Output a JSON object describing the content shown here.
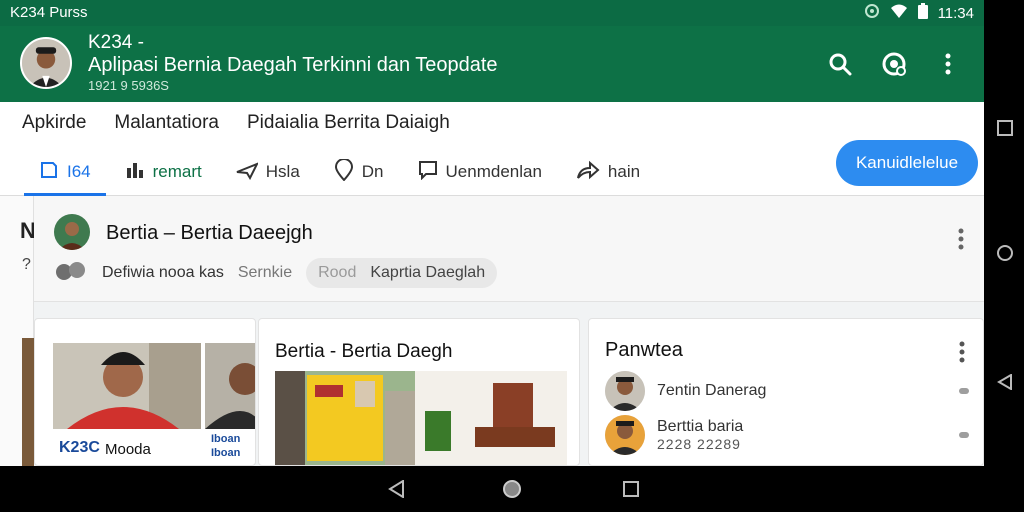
{
  "status_bar": {
    "carrier": "K234 Purss",
    "time": "11:34"
  },
  "app_bar": {
    "title_line1": "K234 -",
    "title_line2": "Aplipasi Bernia Daegah Terkinni dan Teopdate",
    "subtitle": "1921 9 5936S",
    "icons": [
      "search-icon",
      "notification-icon",
      "more-vertical-icon"
    ]
  },
  "breadcrumbs": [
    "Apkirde",
    "Malantatiora",
    "Pidaialia Berrita Daiaigh"
  ],
  "tabs": [
    {
      "icon": "document-icon",
      "label": "I64",
      "active": true
    },
    {
      "icon": "bar-chart-icon",
      "label": "remart",
      "active": false
    },
    {
      "icon": "plane-icon",
      "label": "Hsla",
      "active": false
    },
    {
      "icon": "pin-icon",
      "label": "Dn",
      "active": false
    },
    {
      "icon": "chat-icon",
      "label": "Uenmdenlan",
      "active": false
    },
    {
      "icon": "share-icon",
      "label": "hain",
      "active": false
    }
  ],
  "primary_button": {
    "label": "Kanuidlelelue"
  },
  "left_stub": {
    "letter": "N",
    "sub": "?"
  },
  "post": {
    "title": "Bertia – Bertia Daeejgh",
    "meta_text": "Defiwia nooa kas",
    "chip_labels": [
      "Sernkie",
      "Rood",
      "Kaprtia Daeglah"
    ]
  },
  "news_card_1": {
    "caption": "Mooda",
    "logo_text": "K23C",
    "overlay": "Iboan",
    "second_caption": "Iboan"
  },
  "news_card_2": {
    "title": "Bertia - Bertia Daegh"
  },
  "trending": {
    "title": "Panwtea",
    "items": [
      {
        "title": "7entin Danerag"
      },
      {
        "title": "Berttia baria",
        "sub": "2228 22289"
      }
    ]
  },
  "colors": {
    "primary_green": "#0d7146",
    "accent_blue": "#2d8cf0",
    "tab_active": "#1a73e8"
  }
}
